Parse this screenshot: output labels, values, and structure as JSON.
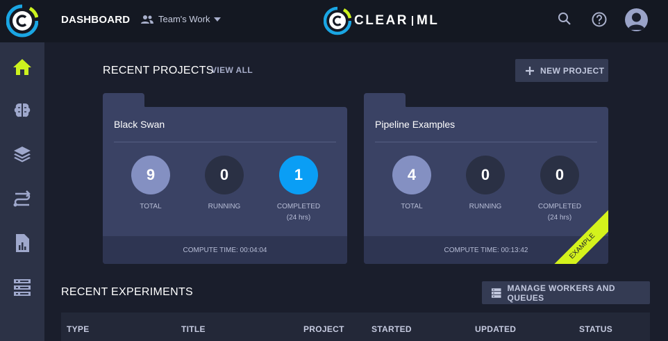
{
  "sidebar": {
    "logo_icon": "clearml-logo-icon",
    "items": [
      {
        "name": "home",
        "icon": "home-icon",
        "active": true
      },
      {
        "name": "projects",
        "icon": "brain-icon"
      },
      {
        "name": "datasets",
        "icon": "layers-icon"
      },
      {
        "name": "pipelines",
        "icon": "pipeline-icon"
      },
      {
        "name": "reports",
        "icon": "report-icon"
      },
      {
        "name": "workers",
        "icon": "server-icon"
      }
    ],
    "accent": "#cdf21e"
  },
  "header": {
    "title": "DASHBOARD",
    "workspace": "Team's Work",
    "brand_left": "CLEAR",
    "brand_right": "ML",
    "search_icon": "search-icon",
    "help_icon": "help-icon",
    "avatar_icon": "user-avatar-icon"
  },
  "projects": {
    "title": "RECENT PROJECTS",
    "view_all": "VIEW ALL",
    "new_button": "NEW PROJECT",
    "cards": [
      {
        "name": "Black Swan",
        "total": "9",
        "running": "0",
        "completed": "1",
        "total_label": "TOTAL",
        "running_label": "RUNNING",
        "completed_label": "COMPLETED",
        "completed_sub": "(24 hrs)",
        "compute_time": "COMPUTE TIME: 00:04:04"
      },
      {
        "name": "Pipeline Examples",
        "total": "4",
        "running": "0",
        "completed": "0",
        "total_label": "TOTAL",
        "running_label": "RUNNING",
        "completed_label": "COMPLETED",
        "completed_sub": "(24 hrs)",
        "compute_time": "COMPUTE TIME: 00:13:42",
        "ribbon": "EXAMPLE"
      }
    ]
  },
  "experiments": {
    "title": "RECENT EXPERIMENTS",
    "manage_button": "MANAGE WORKERS AND QUEUES",
    "columns": [
      "TYPE",
      "TITLE",
      "PROJECT",
      "STARTED",
      "UPDATED",
      "STATUS"
    ]
  }
}
